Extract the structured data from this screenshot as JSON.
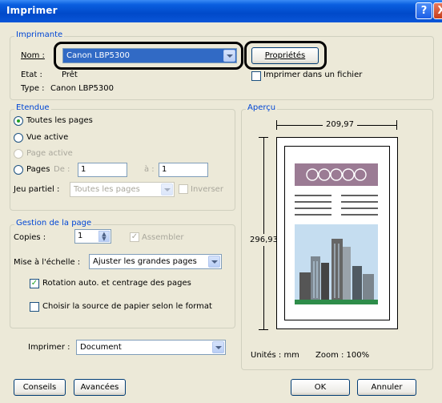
{
  "window": {
    "title": "Imprimer",
    "help_label": "?",
    "close_label": "X"
  },
  "printer": {
    "group_label": "Imprimante",
    "name_label": "Nom :",
    "name_value": "Canon LBP5300",
    "properties_label": "Propriétés",
    "state_label": "Etat :",
    "state_value": "Prêt",
    "type_label": "Type :",
    "type_value": "Canon LBP5300",
    "print_to_file_label": "Imprimer dans un fichier"
  },
  "range": {
    "group_label": "Etendue",
    "all_pages": "Toutes les pages",
    "current_view": "Vue active",
    "current_page": "Page active",
    "pages": "Pages",
    "from_label": "De :",
    "from_value": "1",
    "to_label": "à :",
    "to_value": "1",
    "subset_label": "Jeu partiel :",
    "subset_value": "Toutes les pages",
    "reverse_label": "Inverser"
  },
  "handling": {
    "group_label": "Gestion de la page",
    "copies_label": "Copies :",
    "copies_value": "1",
    "collate_label": "Assembler",
    "scaling_label": "Mise à l'échelle :",
    "scaling_value": "Ajuster les grandes pages",
    "autorotate_label": "Rotation auto. et centrage des pages",
    "choose_source_label": "Choisir la source de papier selon le format"
  },
  "print_what": {
    "label": "Imprimer :",
    "value": "Document"
  },
  "preview": {
    "group_label": "Aperçu",
    "width_value": "209,97",
    "height_value": "296,93",
    "units_label": "Unités : mm",
    "zoom_label": "Zoom : 100%"
  },
  "buttons": {
    "tips": "Conseils",
    "advanced": "Avancées",
    "ok": "OK",
    "cancel": "Annuler"
  },
  "colors": {
    "title_bar": "#0a5fe0",
    "accent": "#0046d5",
    "preview_banner": "#9b7b94",
    "preview_sky": "#c5ddf0"
  }
}
